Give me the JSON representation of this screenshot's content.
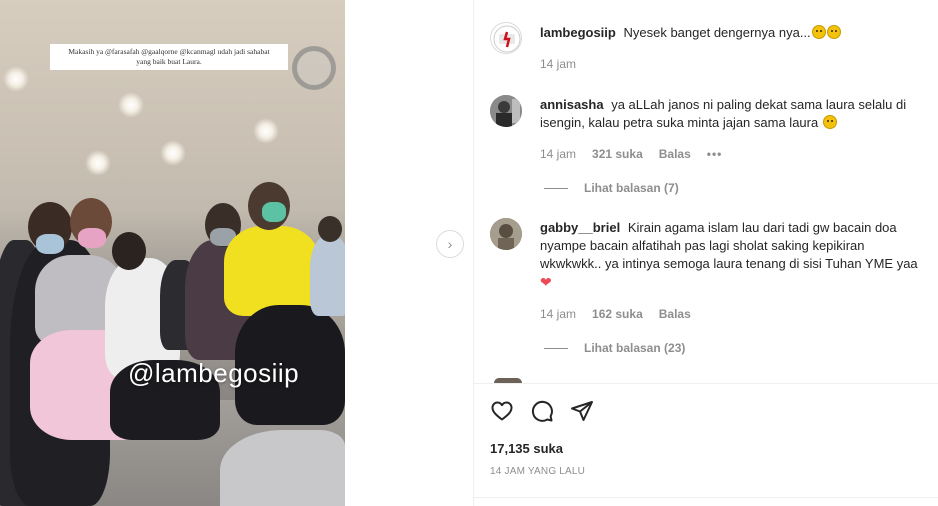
{
  "post": {
    "caption_user": "lambegosiip",
    "caption_text": "Nyesek banget dengernya nya...",
    "caption_time": "14 jam",
    "likes": "17,135 suka",
    "time_ago": "14 JAM YANG LALU"
  },
  "media": {
    "overlay_line1": "Makasih ya @farasafah @gaalqorne @kcanmagl udah jadi sahabat",
    "overlay_line2": "yang baik buat Laura.",
    "watermark": "@lambegosiip",
    "next_glyph": "›"
  },
  "comments": [
    {
      "user": "annisasha",
      "text": "ya aLLah janos ni paling dekat sama laura selalu di isengin, kalau petra suka minta jajan sama laura",
      "time": "14 jam",
      "likes": "321 suka",
      "reply": "Balas",
      "more": "•••",
      "view_replies": "Lihat balasan (7)"
    },
    {
      "user": "gabby__briel",
      "text": "Kirain agama islam lau dari tadi gw bacain doa nyampe bacain alfatihah pas lagi sholat saking kepikiran wkwkwkk.. ya intinya semoga laura tenang di sisi Tuhan YME yaa",
      "time": "14 jam",
      "likes": "162 suka",
      "reply": "Balas",
      "view_replies": "Lihat balasan (23)"
    }
  ],
  "icons": {
    "like": "heart-outline-icon",
    "comment": "comment-bubble-icon",
    "share": "paper-plane-icon",
    "emoji_sad": "sad-face-emoji",
    "emoji_heart": "red-heart-emoji"
  },
  "colors": {
    "text": "#262626",
    "muted": "#8e8e8e",
    "heart": "#ed4956",
    "divider": "#efefef"
  }
}
